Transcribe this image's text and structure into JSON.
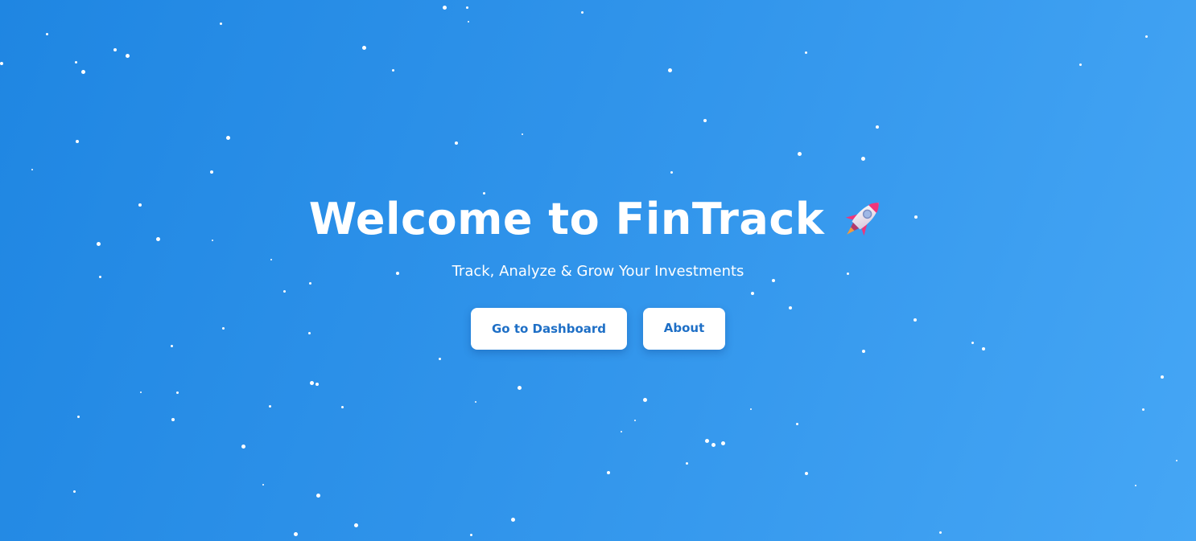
{
  "hero": {
    "title": "Welcome to FinTrack",
    "title_icon": "rocket-icon",
    "subtitle": "Track, Analyze & Grow Your Investments"
  },
  "actions": {
    "dashboard_label": "Go to Dashboard",
    "about_label": "About"
  },
  "colors": {
    "background_start": "#1f86e2",
    "background_end": "#45a6f5",
    "button_background": "#ffffff",
    "button_text": "#1e6fc6"
  }
}
